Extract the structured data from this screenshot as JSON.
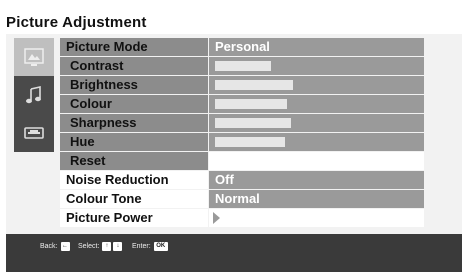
{
  "menu": {
    "title": "Picture Adjustment",
    "icons": [
      "picture-icon",
      "sound-icon",
      "settings-icon"
    ],
    "rows": [
      {
        "label": "Picture Mode",
        "value": "Personal"
      },
      {
        "label": "Contrast",
        "level": 0.28
      },
      {
        "label": "Brightness",
        "level": 0.39
      },
      {
        "label": "Colour",
        "level": 0.36
      },
      {
        "label": "Sharpness",
        "level": 0.38
      },
      {
        "label": "Hue",
        "level": 0.35
      },
      {
        "label": "Reset"
      },
      {
        "label": "Noise Reduction",
        "value": "Off"
      },
      {
        "label": "Colour Tone",
        "value": "Normal"
      },
      {
        "label": "Picture Power"
      }
    ]
  },
  "footer": {
    "back_label": "Back:",
    "back_key": "←",
    "select_label": "Select:",
    "select_keys": [
      "↑",
      "↓"
    ],
    "enter_label": "Enter:",
    "enter_key": "OK"
  },
  "colors": {
    "label_bg": "#8c8c8c",
    "value_bg": "#9a9a9a",
    "footer_bg": "#3a3a3a"
  }
}
